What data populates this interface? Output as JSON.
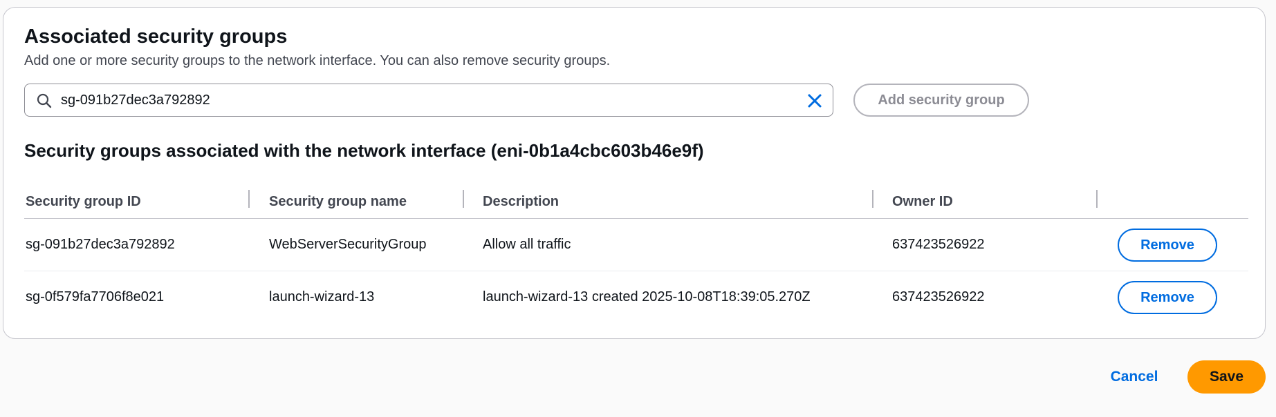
{
  "section": {
    "title": "Associated security groups",
    "description": "Add one or more security groups to the network interface. You can also remove security groups."
  },
  "search": {
    "value": "sg-091b27dec3a792892",
    "search_icon": "search-icon",
    "clear_icon": "close-icon"
  },
  "add_button": {
    "label": "Add security group",
    "disabled": true
  },
  "table": {
    "title": "Security groups associated with the network interface (eni-0b1a4cbc603b46e9f)",
    "columns": [
      "Security group ID",
      "Security group name",
      "Description",
      "Owner ID"
    ],
    "rows": [
      {
        "id": "sg-091b27dec3a792892",
        "name": "WebServerSecurityGroup",
        "description": "Allow all traffic",
        "owner": "637423526922",
        "action": "Remove"
      },
      {
        "id": "sg-0f579fa7706f8e021",
        "name": "launch-wizard-13",
        "description": "launch-wizard-13 created 2025-10-08T18:39:05.270Z",
        "owner": "637423526922",
        "action": "Remove"
      }
    ]
  },
  "footer": {
    "cancel_label": "Cancel",
    "save_label": "Save"
  },
  "colors": {
    "accent": "#006ce0",
    "primary_button": "#ff9900",
    "border": "#c6c6cd"
  }
}
